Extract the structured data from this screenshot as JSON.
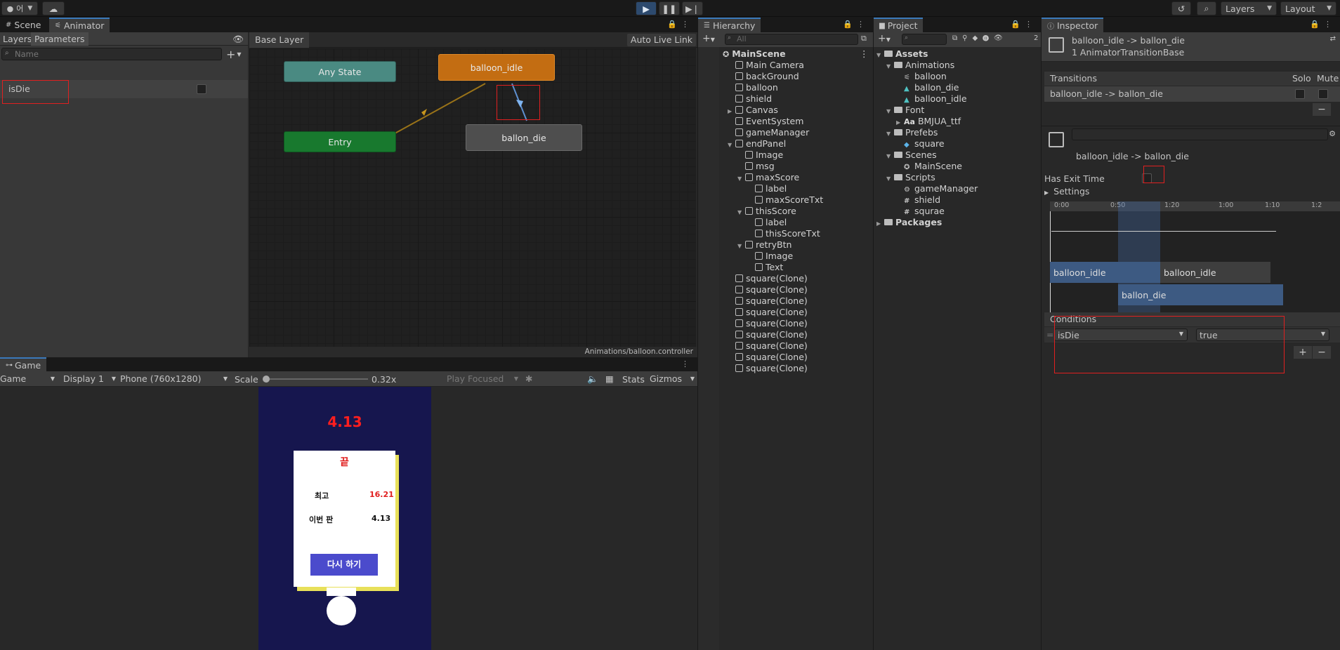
{
  "toolbar": {
    "account_label": "어",
    "layers_label": "Layers",
    "layout_label": "Layout"
  },
  "scene_tab": "Scene",
  "animator": {
    "tab": "Animator",
    "layers_tab": "Layers",
    "parameters_tab": "Parameters",
    "search_placeholder": "Name",
    "param_name": "isDie",
    "breadcrumb": "Base Layer",
    "auto_live_link": "Auto Live Link",
    "states": {
      "any_state": "Any State",
      "entry": "Entry",
      "balloon_idle": "balloon_idle",
      "ballon_die": "ballon_die"
    },
    "footer_path": "Animations/balloon.controller"
  },
  "game": {
    "tab": "Game",
    "mode": "Game",
    "display": "Display 1",
    "resolution": "Phone (760x1280)",
    "scale_label": "Scale",
    "scale_value": "0.32x",
    "play_focused": "Play Focused",
    "stats": "Stats",
    "gizmos": "Gizmos",
    "timer": "4.13",
    "panel_title": "끝",
    "best_label": "최고",
    "best_value": "16.21",
    "current_label": "이번 판",
    "current_value": "4.13",
    "retry_label": "다시 하기"
  },
  "hierarchy": {
    "tab": "Hierarchy",
    "search_placeholder": "All",
    "items": [
      {
        "label": "MainScene",
        "depth": 0,
        "fold": "▼",
        "kind": "scene"
      },
      {
        "label": "Main Camera",
        "depth": 1,
        "fold": "",
        "kind": "cube"
      },
      {
        "label": "backGround",
        "depth": 1,
        "fold": "",
        "kind": "cube"
      },
      {
        "label": "balloon",
        "depth": 1,
        "fold": "",
        "kind": "cube"
      },
      {
        "label": "shield",
        "depth": 1,
        "fold": "",
        "kind": "cube"
      },
      {
        "label": "Canvas",
        "depth": 1,
        "fold": "▶",
        "kind": "cube"
      },
      {
        "label": "EventSystem",
        "depth": 1,
        "fold": "",
        "kind": "cube"
      },
      {
        "label": "gameManager",
        "depth": 1,
        "fold": "",
        "kind": "cube"
      },
      {
        "label": "endPanel",
        "depth": 1,
        "fold": "▼",
        "kind": "cube"
      },
      {
        "label": "Image",
        "depth": 2,
        "fold": "",
        "kind": "cube"
      },
      {
        "label": "msg",
        "depth": 2,
        "fold": "",
        "kind": "cube"
      },
      {
        "label": "maxScore",
        "depth": 2,
        "fold": "▼",
        "kind": "cube"
      },
      {
        "label": "label",
        "depth": 3,
        "fold": "",
        "kind": "cube"
      },
      {
        "label": "maxScoreTxt",
        "depth": 3,
        "fold": "",
        "kind": "cube"
      },
      {
        "label": "thisScore",
        "depth": 2,
        "fold": "▼",
        "kind": "cube"
      },
      {
        "label": "label",
        "depth": 3,
        "fold": "",
        "kind": "cube"
      },
      {
        "label": "thisScoreTxt",
        "depth": 3,
        "fold": "",
        "kind": "cube"
      },
      {
        "label": "retryBtn",
        "depth": 2,
        "fold": "▼",
        "kind": "cube"
      },
      {
        "label": "Image",
        "depth": 3,
        "fold": "",
        "kind": "cube"
      },
      {
        "label": "Text",
        "depth": 3,
        "fold": "",
        "kind": "cube"
      },
      {
        "label": "square(Clone)",
        "depth": 1,
        "fold": "",
        "kind": "cube"
      },
      {
        "label": "square(Clone)",
        "depth": 1,
        "fold": "",
        "kind": "cube"
      },
      {
        "label": "square(Clone)",
        "depth": 1,
        "fold": "",
        "kind": "cube"
      },
      {
        "label": "square(Clone)",
        "depth": 1,
        "fold": "",
        "kind": "cube"
      },
      {
        "label": "square(Clone)",
        "depth": 1,
        "fold": "",
        "kind": "cube"
      },
      {
        "label": "square(Clone)",
        "depth": 1,
        "fold": "",
        "kind": "cube"
      },
      {
        "label": "square(Clone)",
        "depth": 1,
        "fold": "",
        "kind": "cube"
      },
      {
        "label": "square(Clone)",
        "depth": 1,
        "fold": "",
        "kind": "cube"
      },
      {
        "label": "square(Clone)",
        "depth": 1,
        "fold": "",
        "kind": "cube"
      }
    ]
  },
  "project": {
    "tab": "Project",
    "hidden_count": "2",
    "items": [
      {
        "label": "Assets",
        "depth": 0,
        "fold": "▼",
        "kind": "folder",
        "bold": true
      },
      {
        "label": "Animations",
        "depth": 1,
        "fold": "▼",
        "kind": "folder"
      },
      {
        "label": "balloon",
        "depth": 2,
        "fold": "",
        "kind": "controller"
      },
      {
        "label": "ballon_die",
        "depth": 2,
        "fold": "",
        "kind": "anim"
      },
      {
        "label": "balloon_idle",
        "depth": 2,
        "fold": "",
        "kind": "anim"
      },
      {
        "label": "Font",
        "depth": 1,
        "fold": "▼",
        "kind": "folder"
      },
      {
        "label": "BMJUA_ttf",
        "depth": 2,
        "fold": "▶",
        "kind": "font"
      },
      {
        "label": "Prefebs",
        "depth": 1,
        "fold": "▼",
        "kind": "folder"
      },
      {
        "label": "square",
        "depth": 2,
        "fold": "",
        "kind": "prefab"
      },
      {
        "label": "Scenes",
        "depth": 1,
        "fold": "▼",
        "kind": "folder"
      },
      {
        "label": "MainScene",
        "depth": 2,
        "fold": "",
        "kind": "scene"
      },
      {
        "label": "Scripts",
        "depth": 1,
        "fold": "▼",
        "kind": "folder"
      },
      {
        "label": "gameManager",
        "depth": 2,
        "fold": "",
        "kind": "gear"
      },
      {
        "label": "shield",
        "depth": 2,
        "fold": "",
        "kind": "script"
      },
      {
        "label": "squrae",
        "depth": 2,
        "fold": "",
        "kind": "script"
      },
      {
        "label": "Packages",
        "depth": 0,
        "fold": "▶",
        "kind": "folder",
        "bold": true
      }
    ]
  },
  "inspector": {
    "tab": "Inspector",
    "title": "balloon_idle -> ballon_die",
    "subtitle": "1 AnimatorTransitionBase",
    "transitions_header": "Transitions",
    "solo": "Solo",
    "mute": "Mute",
    "transition_item": "balloon_idle -> ballon_die",
    "transition_label": "balloon_idle -> ballon_die",
    "has_exit_time": "Has Exit Time",
    "settings": "Settings",
    "ticks": [
      "0:00",
      "0:50",
      "1:20",
      "1:00",
      "1:10",
      "1:2"
    ],
    "clip_a": "balloon_idle",
    "clip_b": "balloon_idle",
    "clip_c": "ballon_die",
    "conditions_header": "Conditions",
    "condition_param": "isDie",
    "condition_value": "true"
  }
}
